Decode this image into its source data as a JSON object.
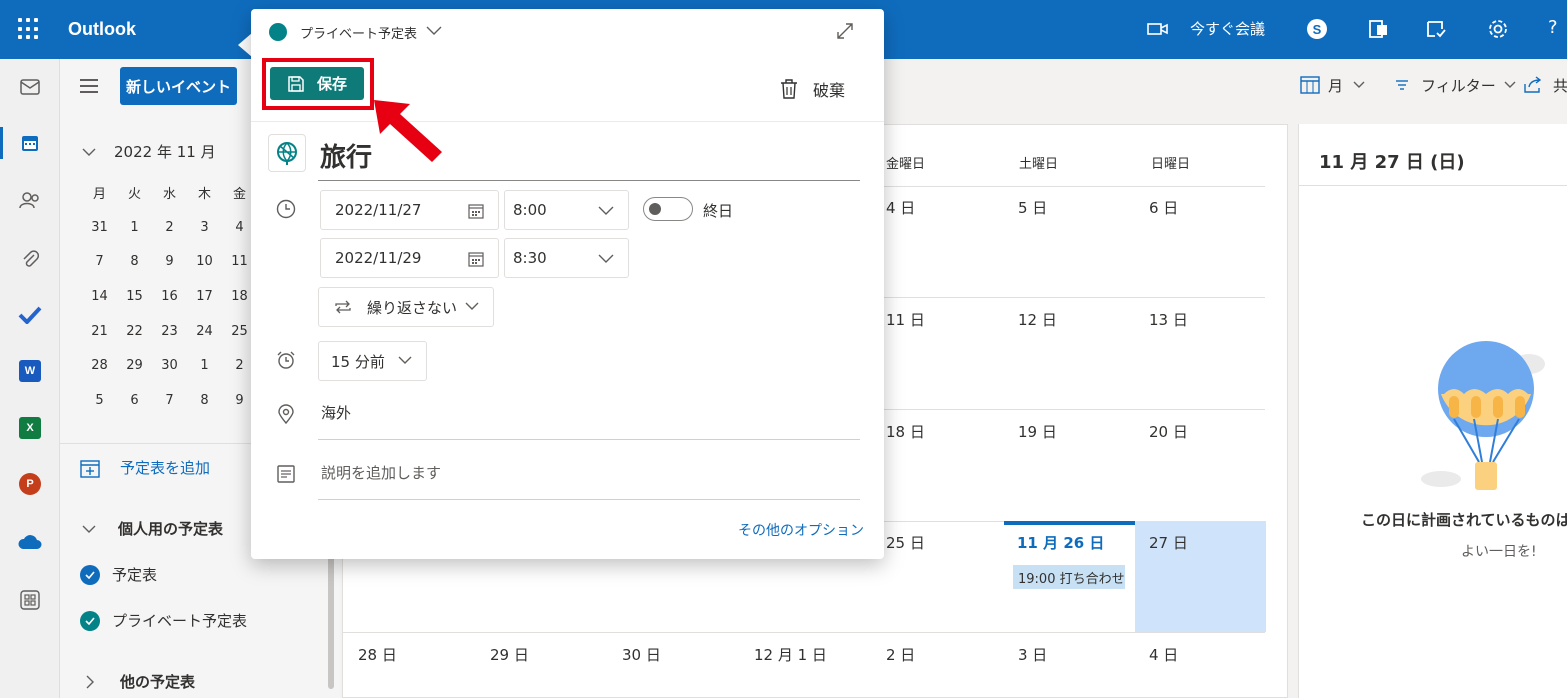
{
  "topbar": {
    "app_title": "Outlook",
    "meet_now": "今すぐ会議",
    "help": "?"
  },
  "rail": {
    "icons": [
      "mail-icon",
      "calendar-icon",
      "people-icon",
      "attach-icon",
      "todo-icon",
      "word-icon",
      "excel-icon",
      "powerpoint-icon",
      "onedrive-icon",
      "apps-icon"
    ],
    "tiles": {
      "word": "W",
      "excel": "X",
      "powerpoint": "P"
    }
  },
  "sidebar": {
    "new_event": "新しいイベント",
    "month_title": "2022 年 11 月",
    "dow": [
      "月",
      "火",
      "水",
      "木",
      "金"
    ],
    "weeks": [
      [
        "31",
        "1",
        "2",
        "3",
        "4"
      ],
      [
        "7",
        "8",
        "9",
        "10",
        "11"
      ],
      [
        "14",
        "15",
        "16",
        "17",
        "18"
      ],
      [
        "21",
        "22",
        "23",
        "24",
        "25"
      ],
      [
        "28",
        "29",
        "30",
        "1",
        "2"
      ],
      [
        "5",
        "6",
        "7",
        "8",
        "9"
      ]
    ],
    "add_calendar": "予定表を追加",
    "personal_group": "個人用の予定表",
    "calendars": [
      "予定表",
      "プライベート予定表"
    ],
    "other_group": "他の予定表"
  },
  "toolbar": {
    "view": "月",
    "filter": "フィルター",
    "share": "共"
  },
  "calendar": {
    "headers": [
      "金曜日",
      "土曜日",
      "日曜日"
    ],
    "rows": [
      [
        "4 日",
        "5 日",
        "6 日"
      ],
      [
        "11 日",
        "12 日",
        "13 日"
      ],
      [
        "18 日",
        "19 日",
        "20 日"
      ],
      [
        "25 日",
        "11 月 26 日",
        "27 日"
      ]
    ],
    "last_row": [
      "28 日",
      "29 日",
      "30 日",
      "12 月 1 日",
      "2 日",
      "3 日",
      "4 日"
    ],
    "event": "19:00 打ち合わせ"
  },
  "day_panel": {
    "title": "11 月 27 日 (日)",
    "empty_message": "この日に計画されているものは",
    "empty_sub": "よい一日を!"
  },
  "popup": {
    "calendar_name": "プライベート予定表",
    "save": "保存",
    "discard": "破棄",
    "title": "旅行",
    "start_date": "2022/11/27",
    "start_time": "8:00",
    "end_date": "2022/11/29",
    "end_time": "8:30",
    "all_day": "終日",
    "repeat": "繰り返さない",
    "reminder": "15 分前",
    "location": "海外",
    "description_placeholder": "説明を追加します",
    "more_options": "その他のオプション"
  },
  "colors": {
    "brand": "#0f6cbd",
    "save_button": "#0f7b78",
    "highlight_border": "#e60012",
    "selected_day": "#cfe4fa"
  }
}
